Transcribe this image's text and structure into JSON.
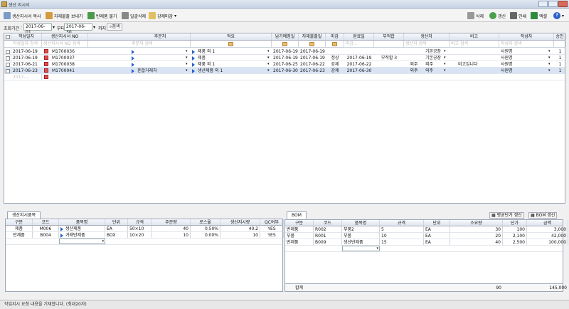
{
  "window": {
    "title": "생산 지시서"
  },
  "toolbar": {
    "copy": "생산지시서 복사",
    "send": "자재불출 보내기",
    "load": "반제품 불기",
    "all_delete": "일괄삭제",
    "close": "강제마감",
    "delete": "삭제",
    "refresh": "갱신",
    "print": "인쇄",
    "excel": "엑셀",
    "help": "?"
  },
  "filter": {
    "label": "조회기간",
    "from": "2017-06-01",
    "mid": "부터",
    "to": "2017-06-30",
    "end": "까지",
    "search": "검색"
  },
  "grid": {
    "columns": [
      "작성일자",
      "생산지시서 NO",
      "주문처",
      "적요",
      "납기예정일",
      "자재불출일",
      "마감",
      "완료일",
      "부적합",
      "생산처",
      "비고",
      "작성자",
      "승인"
    ],
    "filter_row": [
      "작성일자 검색",
      "생산지시서 NO 검색",
      "주문처 검색",
      "",
      "",
      "",
      "",
      "마감...",
      "",
      "생산처 검색",
      "비고 검색",
      "작성자 검색",
      ""
    ],
    "rows": [
      [
        "2017-06-19",
        "M1700036",
        "",
        "제품 외 1",
        "2017-06-19",
        "2017-06-19",
        "",
        "",
        "",
        "",
        "기본공장",
        "",
        "사원명",
        "1"
      ],
      [
        "2017-06-19",
        "M1700037",
        "",
        "제품",
        "2017-06-19",
        "2017-06-19",
        "정상",
        "2017-06-19",
        "부적합 3",
        "",
        "기본공장",
        "",
        "사원명",
        "1"
      ],
      [
        "2017-06-21",
        "M1700038",
        "",
        "제품 외 1",
        "2017-06-25",
        "2017-06-22",
        "강제",
        "2017-06-22",
        "",
        "외주",
        "외주",
        "비고입니다",
        "사원명",
        "1"
      ],
      [
        "2017-06-23",
        "M1700041",
        "혼합거래처",
        "생산제품 외 1",
        "2017-06-30",
        "2017-06-23",
        "강제",
        "2017-06-30",
        "",
        "외주",
        "외주",
        "",
        "사원명",
        "1"
      ]
    ],
    "new_row_date": "2017-..."
  },
  "left_panel": {
    "tab": "생산지시품목",
    "columns": [
      "구분",
      "코드",
      "품목명",
      "단위",
      "규격",
      "주문량",
      "로스율",
      "생산지시량",
      "QC여부"
    ],
    "rows": [
      [
        "제품",
        "M006",
        "생산제품",
        "EA",
        "50×10",
        "40",
        "0.50%",
        "40.2",
        "YES"
      ],
      [
        "반제품",
        "B004",
        "거래반제품",
        "BOX",
        "10×20",
        "10",
        "0.00%",
        "10",
        "YES"
      ]
    ]
  },
  "right_panel": {
    "tab": "BOM",
    "btn_avg": "평균단가 갱신",
    "btn_bom": "BOM 갱신",
    "columns": [
      "구분",
      "코드",
      "품목명",
      "규격",
      "단위",
      "소요량",
      "단가",
      "금액",
      "비고"
    ],
    "rows": [
      [
        "반제품",
        "R002",
        "부품2",
        "5",
        "EA",
        "30",
        "100",
        "3,000",
        ""
      ],
      [
        "부품",
        "R001",
        "부품",
        "10",
        "EA",
        "20",
        "2,100",
        "42,000",
        ""
      ],
      [
        "반제품",
        "B009",
        "생산반제품",
        "15",
        "EA",
        "40",
        "2,500",
        "100,000",
        ""
      ]
    ],
    "total_label": "합계",
    "total_qty": "90",
    "total_amount": "145,000"
  },
  "status": "작업지시 요청 내용을 기재합니다. (최대20자)"
}
